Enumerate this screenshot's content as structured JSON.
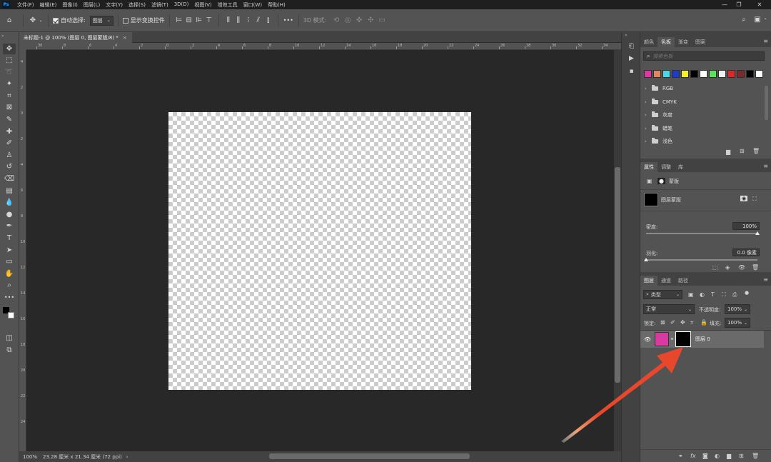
{
  "app": {
    "logo": "Ps"
  },
  "menubar": {
    "items": [
      "文件(F)",
      "编辑(E)",
      "图像(I)",
      "图层(L)",
      "文字(Y)",
      "选择(S)",
      "滤镜(T)",
      "3D(D)",
      "视图(V)",
      "增效工具",
      "窗口(W)",
      "帮助(H)"
    ],
    "window_controls": {
      "minimize": "—",
      "restore": "❐",
      "close": "✕"
    }
  },
  "options_bar": {
    "auto_select_label": "自动选择:",
    "auto_select_checked": true,
    "auto_select_target": "图层",
    "show_transform_label": "显示变换控件",
    "show_transform_checked": false,
    "mode_3d_label": "3D 模式:",
    "more_label": "•••"
  },
  "document": {
    "tab_title": "未标题-1 @ 100% (图层 0, 图层蒙版/8) *",
    "close_label": "×",
    "zoom": "100%",
    "size_info": "23.28 厘米 x 21.34 厘米 (72 ppi)",
    "status_arrow": "›"
  },
  "rulers": {
    "horizontal": [
      "30",
      "8",
      "6",
      "4",
      "2",
      "0",
      "2",
      "4",
      "6",
      "8",
      "10",
      "12",
      "14",
      "16",
      "18",
      "20",
      "22",
      "24",
      "26",
      "28",
      "30",
      "32",
      "34",
      "36"
    ],
    "vertical": [
      "4",
      "2",
      "0",
      "2",
      "4",
      "6",
      "8",
      "10",
      "12",
      "14",
      "16",
      "18",
      "20",
      "22",
      "24"
    ]
  },
  "swatches_panel": {
    "tabs": [
      "颜色",
      "色板",
      "渐变",
      "图案"
    ],
    "active_tab": "色板",
    "search_placeholder": "搜索色板",
    "swatch_colors": [
      "#d83aa0",
      "#e0875e",
      "#4fd6e6",
      "#1d3cc8",
      "#f5f22a",
      "#000000",
      "#ffffff",
      "#5ee05e",
      "#f0f0f0",
      "#d82a2a",
      "#7a2a2a",
      "#000000",
      "#ffffff"
    ],
    "groups": [
      "RGB",
      "CMYK",
      "灰度",
      "蜡笔",
      "浅色"
    ]
  },
  "properties_panel": {
    "tabs": [
      "属性",
      "调整",
      "库"
    ],
    "active_tab": "属性",
    "header_label": "蒙版",
    "mask_label": "图层蒙版",
    "density_label": "密度:",
    "density_value": "100%",
    "density_fraction": 1.0,
    "feather_label": "羽化:",
    "feather_value": "0.0 像素",
    "feather_fraction": 0.0
  },
  "layers_panel": {
    "tabs": [
      "图层",
      "通道",
      "路径"
    ],
    "active_tab": "图层",
    "filter_label": "类型",
    "blend_mode": "正常",
    "opacity_label": "不透明度:",
    "opacity_value": "100%",
    "lock_label": "锁定:",
    "fill_label": "填充:",
    "fill_value": "100%",
    "layers": [
      {
        "name": "图层 0",
        "thumb_color": "#d83aa0",
        "mask_color": "#000000",
        "visible": true
      }
    ]
  },
  "colors": {
    "accent_arrow": "#e8472c",
    "foreground": "#000000",
    "background": "#ffffff"
  }
}
